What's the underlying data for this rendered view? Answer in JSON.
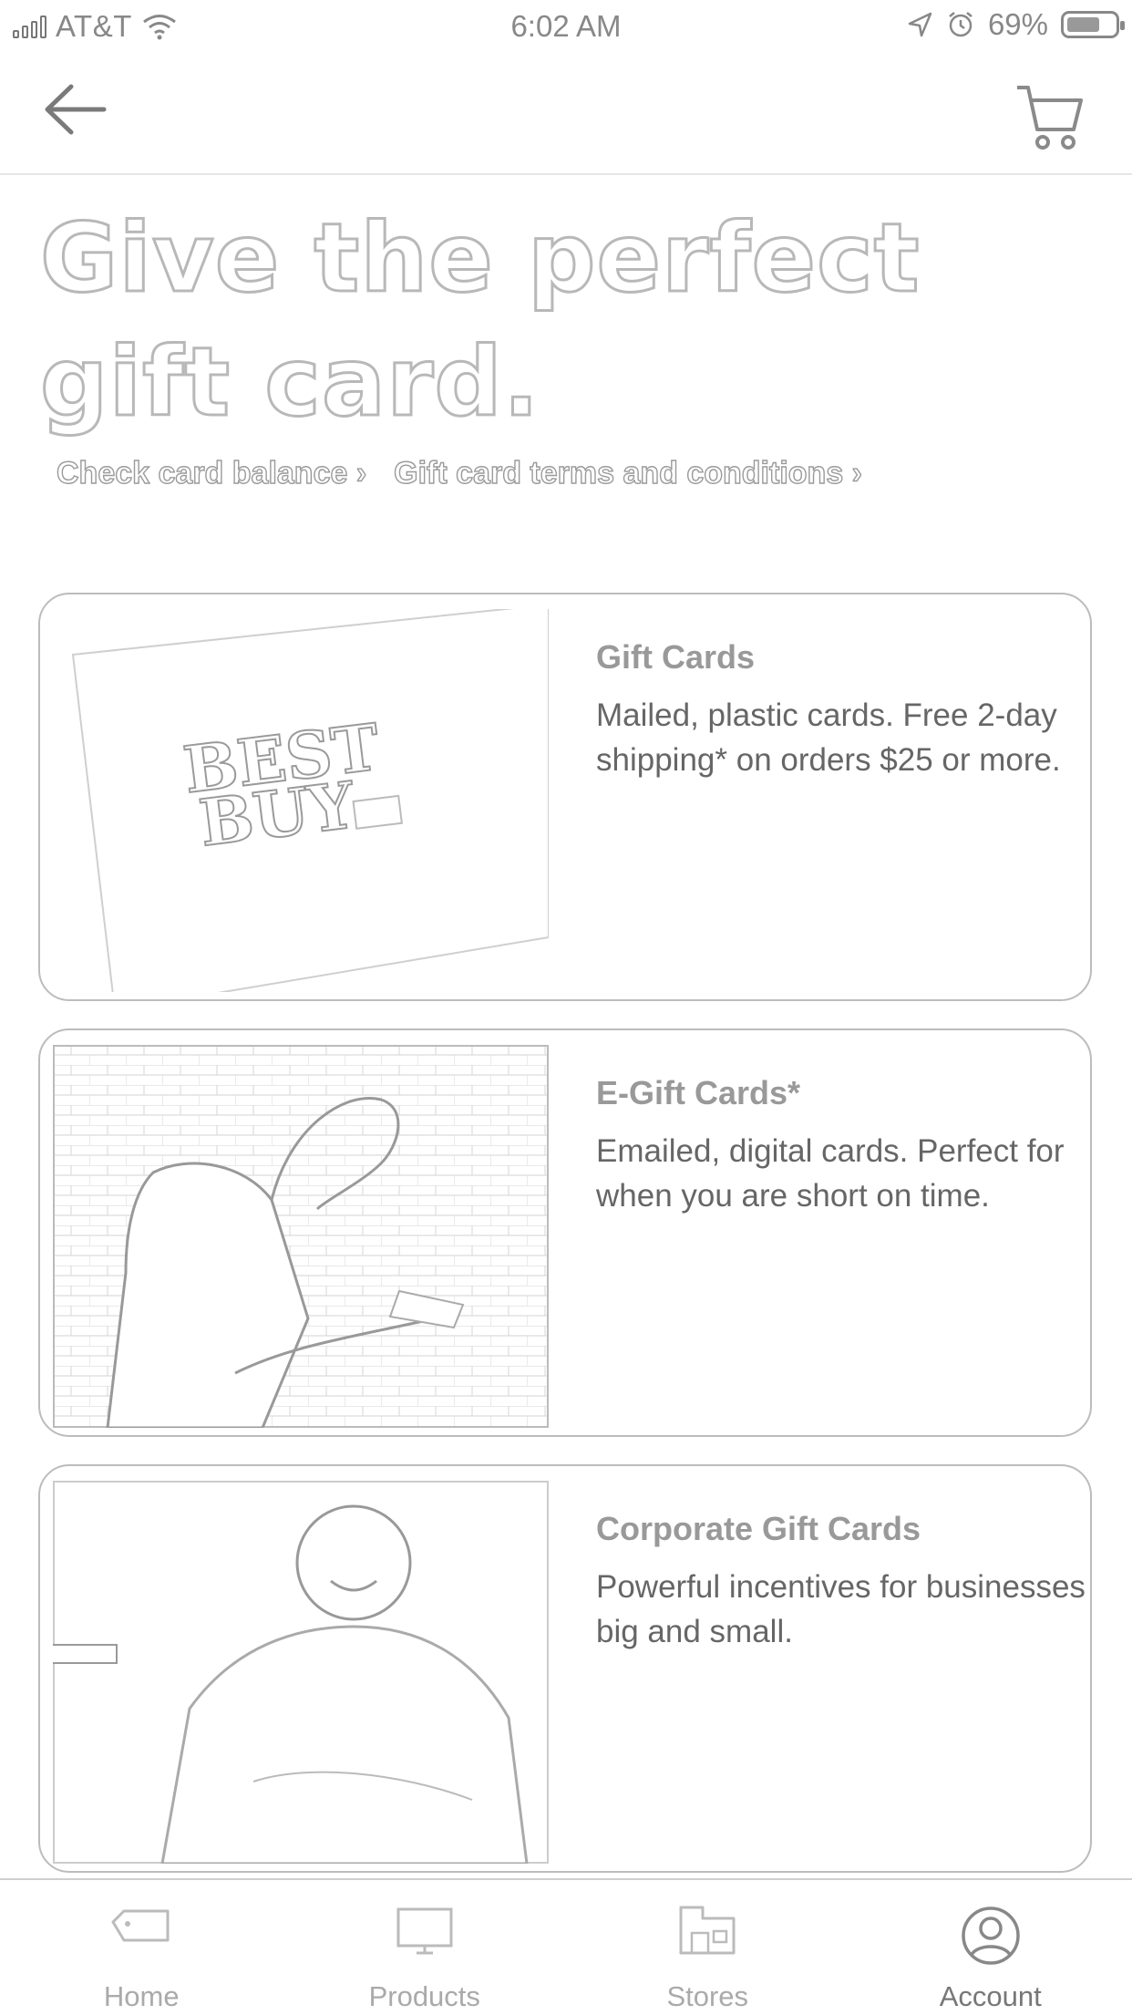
{
  "status_bar": {
    "carrier": "AT&T",
    "time": "6:02 AM",
    "battery_percent": "69%",
    "battery_level": 0.69
  },
  "header": {
    "back_icon": "arrow-left-icon",
    "cart_icon": "shopping-cart-icon"
  },
  "hero": {
    "title": "Give the perfect gift card.",
    "links": [
      {
        "label": "Check card balance ›"
      },
      {
        "label": "Gift card terms and conditions ›"
      }
    ]
  },
  "cards": [
    {
      "title": "Gift Cards",
      "description": "Mailed, plastic cards. Free 2-day shipping* on orders $25 or more.",
      "image_text": [
        "BEST",
        "BUY"
      ]
    },
    {
      "title": "E-Gift Cards*",
      "description": "Emailed, digital cards. Perfect for when you are short on time."
    },
    {
      "title": "Corporate Gift Cards",
      "description": "Powerful incentives for businesses big and small."
    }
  ],
  "tab_bar": {
    "tabs": [
      {
        "label": "Home",
        "icon": "price-tag-icon"
      },
      {
        "label": "Products",
        "icon": "monitor-icon"
      },
      {
        "label": "Stores",
        "icon": "store-icon"
      },
      {
        "label": "Account",
        "icon": "account-icon",
        "active": true
      }
    ]
  }
}
